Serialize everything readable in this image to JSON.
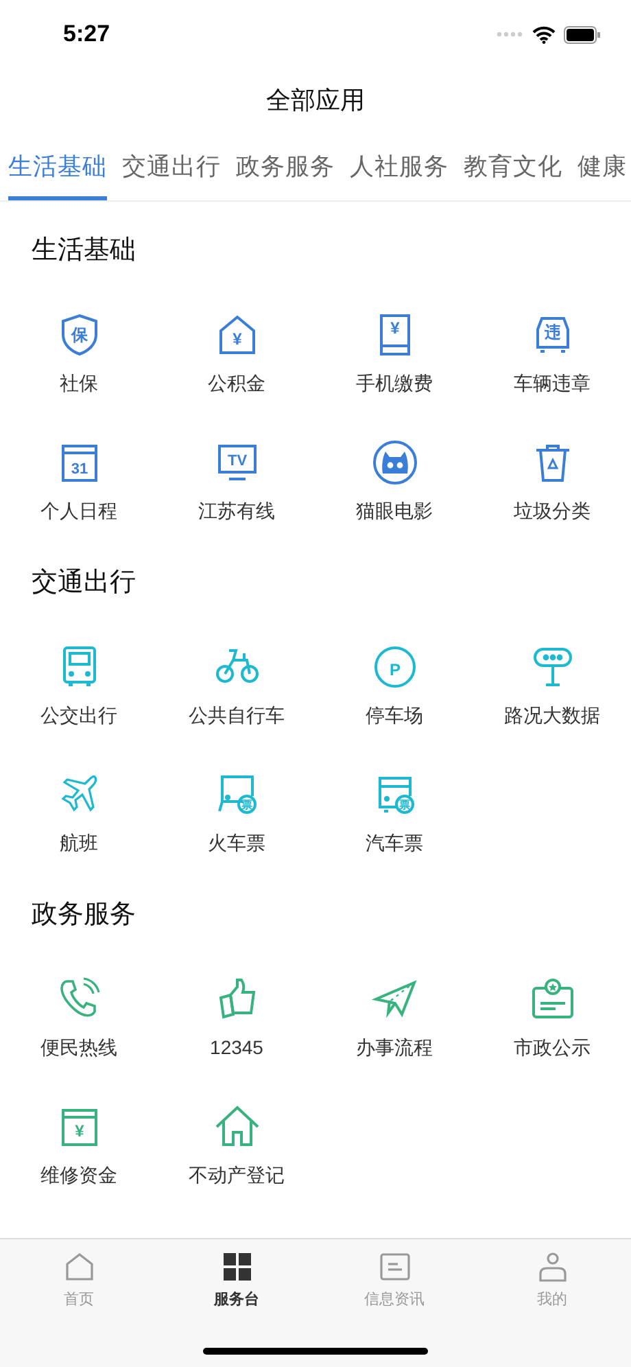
{
  "status_bar": {
    "time": "5:27"
  },
  "title": "全部应用",
  "tabs": [
    {
      "label": "生活基础",
      "selected": true
    },
    {
      "label": "交通出行",
      "selected": false
    },
    {
      "label": "政务服务",
      "selected": false
    },
    {
      "label": "人社服务",
      "selected": false
    },
    {
      "label": "教育文化",
      "selected": false
    },
    {
      "label": "健康",
      "selected": false
    }
  ],
  "sections": [
    {
      "heading": "生活基础",
      "color": "#3a7ed8",
      "items": [
        {
          "label": "社保",
          "badge": "保"
        },
        {
          "label": "公积金",
          "badge": "¥"
        },
        {
          "label": "手机缴费",
          "badge": "¥"
        },
        {
          "label": "车辆违章",
          "badge": "违"
        },
        {
          "label": "个人日程",
          "badge": "31"
        },
        {
          "label": "江苏有线",
          "badge": "TV"
        },
        {
          "label": "猫眼电影"
        },
        {
          "label": "垃圾分类"
        }
      ]
    },
    {
      "heading": "交通出行",
      "color": "#1db9d1",
      "items": [
        {
          "label": "公交出行"
        },
        {
          "label": "公共自行车"
        },
        {
          "label": "停车场",
          "badge": "P"
        },
        {
          "label": "路况大数据"
        },
        {
          "label": "航班"
        },
        {
          "label": "火车票",
          "badge": "票"
        },
        {
          "label": "汽车票",
          "badge": "票"
        }
      ]
    },
    {
      "heading": "政务服务",
      "color": "#38b27e",
      "items": [
        {
          "label": "便民热线"
        },
        {
          "label": "12345"
        },
        {
          "label": "办事流程"
        },
        {
          "label": "市政公示"
        },
        {
          "label": "维修资金",
          "badge": "¥"
        },
        {
          "label": "不动产登记"
        }
      ]
    }
  ],
  "bottom_nav": [
    {
      "label": "首页",
      "selected": false
    },
    {
      "label": "服务台",
      "selected": true
    },
    {
      "label": "信息资讯",
      "selected": false
    },
    {
      "label": "我的",
      "selected": false
    }
  ]
}
